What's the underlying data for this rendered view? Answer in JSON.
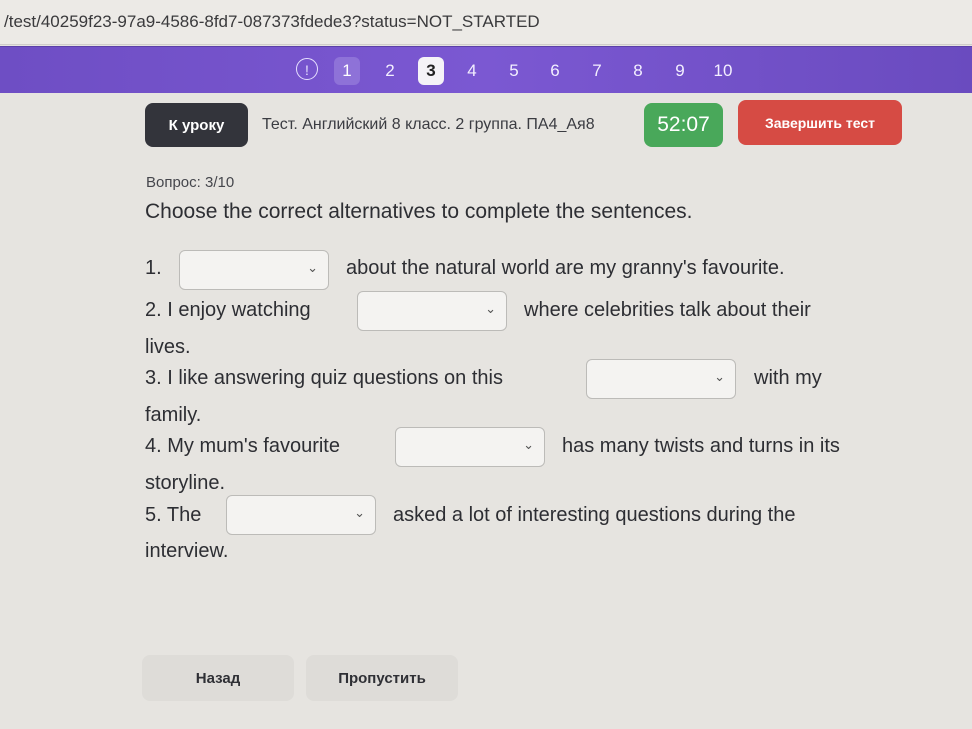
{
  "browser": {
    "url": "/test/40259f23-97a9-4586-8fd7-087373fdede3?status=NOT_STARTED"
  },
  "navigation": {
    "alert_icon": "!",
    "questions": [
      "1",
      "2",
      "3",
      "4",
      "5",
      "6",
      "7",
      "8",
      "9",
      "10"
    ],
    "current": "3"
  },
  "header": {
    "back_label": "К уроку",
    "test_title": "Тест. Английский 8 класс. 2 группа. ПА4_Ая8",
    "timer": "52:07",
    "finish_label": "Завершить тест"
  },
  "question": {
    "counter": "Вопрос: 3/10",
    "instruction": "Choose the correct alternatives to complete the sentences.",
    "lines": {
      "s1a": "1.",
      "s1b": "about the natural world are my granny's favourite.",
      "s2a": "2. I enjoy watching",
      "s2b": "where celebrities talk about their",
      "s2c": "lives.",
      "s3a": "3. I like answering quiz questions on this",
      "s3b": "with my",
      "s3c": "family.",
      "s4a": "4. My mum's favourite",
      "s4b": "has many twists and turns in its",
      "s4c": "storyline.",
      "s5a": "5. The",
      "s5b": "asked a lot of interesting questions during the",
      "s5c": "interview."
    },
    "selects": [
      "",
      "",
      "",
      "",
      ""
    ],
    "select_icon": "chevron-down-icon"
  },
  "footer": {
    "back_label": "Назад",
    "skip_label": "Пропустить"
  }
}
